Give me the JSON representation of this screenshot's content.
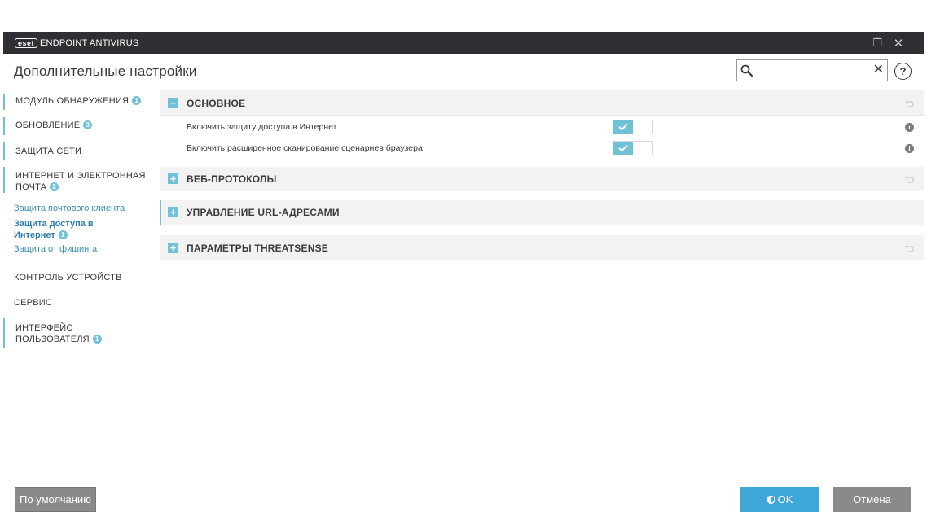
{
  "window": {
    "logo": "eset",
    "product": "ENDPOINT ANTIVIRUS",
    "restore_icon": "❐",
    "close_icon": "✕"
  },
  "header": {
    "title": "Дополнительные настройки",
    "search_placeholder": "",
    "search_clear": "✕",
    "help": "?"
  },
  "sidebar": {
    "items": [
      {
        "label": "МОДУЛЬ ОБНАРУЖЕНИЯ",
        "badge": "1"
      },
      {
        "label": "ОБНОВЛЕНИЕ",
        "badge": "3"
      },
      {
        "label": "ЗАЩИТА СЕТИ"
      },
      {
        "label_line1": "ИНТЕРНЕТ И ЭЛЕКТРОННАЯ",
        "label_line2": "ПОЧТА",
        "badge": "2"
      },
      {
        "label": "КОНТРОЛЬ УСТРОЙСТВ"
      },
      {
        "label": "СЕРВИС"
      },
      {
        "label_line1": "ИНТЕРФЕЙС",
        "label_line2": "ПОЛЬЗОВАТЕЛЯ",
        "badge": "1"
      }
    ],
    "subitems": [
      {
        "label": "Защита почтового клиента"
      },
      {
        "label_line1": "Защита доступа в",
        "label_line2": "Интернет",
        "badge": "1"
      },
      {
        "label": "Защита от фишинга"
      }
    ]
  },
  "sections": [
    {
      "title": "ОСНОВНОЕ",
      "toggle": "−"
    },
    {
      "title": "ВЕБ-ПРОТОКОЛЫ",
      "toggle": "+"
    },
    {
      "title": "УПРАВЛЕНИЕ URL-АДРЕСАМИ",
      "toggle": "+"
    },
    {
      "title": "ПАРАМЕТРЫ THREATSENSE",
      "toggle": "+"
    }
  ],
  "settings": [
    {
      "label": "Включить защиту доступа в Интернет",
      "enabled": true,
      "info": "i"
    },
    {
      "label": "Включить расширенное сканирование сценариев браузера",
      "enabled": true,
      "info": "i"
    }
  ],
  "footer": {
    "default_label": "По умолчанию",
    "ok_label": "OK",
    "cancel_label": "Отмена"
  },
  "colors": {
    "accent": "#6fc1d7",
    "ok_button": "#3fa6d8",
    "titlebar": "#2e3033",
    "gray_button": "#8a8a8a"
  }
}
